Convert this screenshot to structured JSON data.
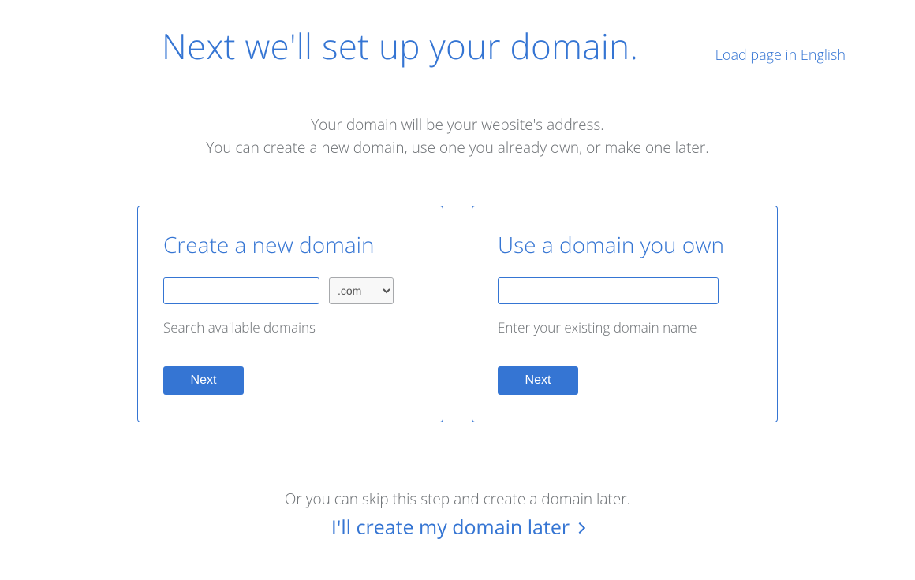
{
  "header": {
    "load_english": "Load page in English",
    "title": "Next we'll set up your domain."
  },
  "subtitle": {
    "line1": "Your domain will be your website's address.",
    "line2": "You can create a new domain, use one you already own, or make one later."
  },
  "create_card": {
    "title": "Create a new domain",
    "input_value": "",
    "tld_selected": ".com",
    "helper": "Search available domains",
    "next_label": "Next"
  },
  "own_card": {
    "title": "Use a domain you own",
    "input_value": "",
    "helper": "Enter your existing domain name",
    "next_label": "Next"
  },
  "skip": {
    "text": "Or you can skip this step and create a domain later.",
    "link": "I'll create my domain later"
  }
}
